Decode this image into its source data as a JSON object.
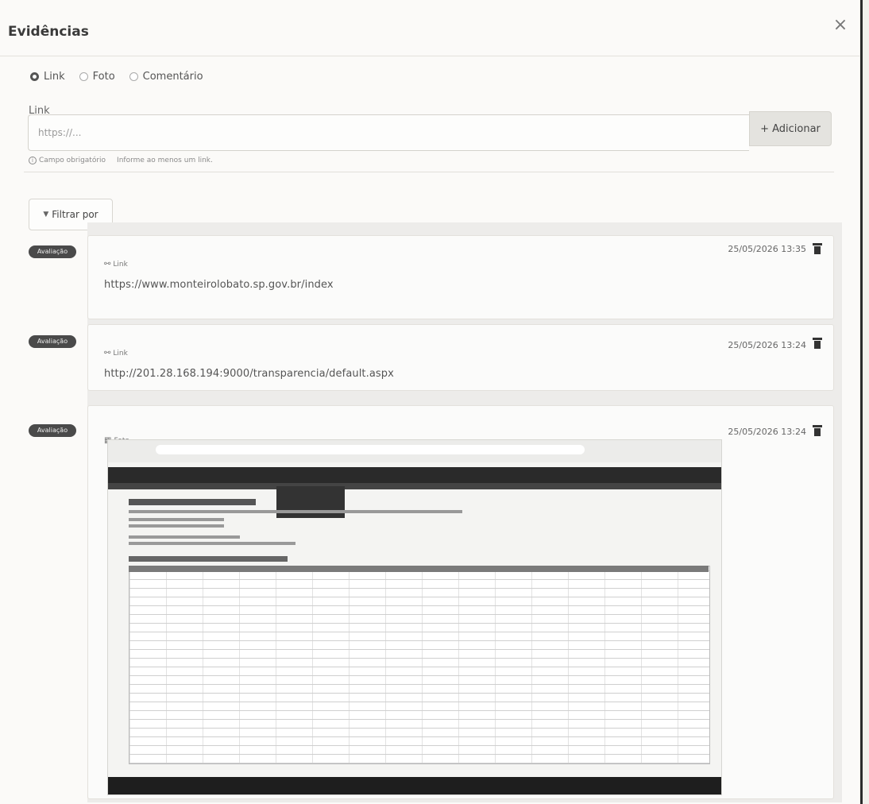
{
  "modal": {
    "title": "Evidências",
    "close_symbol": "×"
  },
  "evidence_type": {
    "options": [
      "Link",
      "Foto",
      "Comentário"
    ],
    "selected": "Link"
  },
  "link_field": {
    "label": "Link",
    "placeholder": "https://...",
    "value": "",
    "required_hint": "Campo obrigatório",
    "helper_hint": "Informe ao menos um link."
  },
  "add_button": {
    "label": "+ Adicionar"
  },
  "filter_button": {
    "label": "Filtrar por",
    "icon": "funnel-icon"
  },
  "evidences": [
    {
      "badge": "Avaliação",
      "type_label": "Link",
      "type_icon": "link-icon",
      "url": "https://www.monteirolobato.sp.gov.br/index",
      "datetime": "25/05/2026 13:35"
    },
    {
      "badge": "Avaliação",
      "type_label": "Link",
      "type_icon": "link-icon",
      "url": "http://201.28.168.194:9000/transparencia/default.aspx",
      "datetime": "25/05/2026 13:24"
    },
    {
      "badge": "Avaliação",
      "type_label": "Foto",
      "type_icon": "image-icon",
      "datetime": "25/05/2026 13:24"
    }
  ],
  "colors": {
    "badge_bg": "#4a4a4a",
    "modal_bg": "#fbfaf8",
    "button_bg": "#e4e3df"
  }
}
